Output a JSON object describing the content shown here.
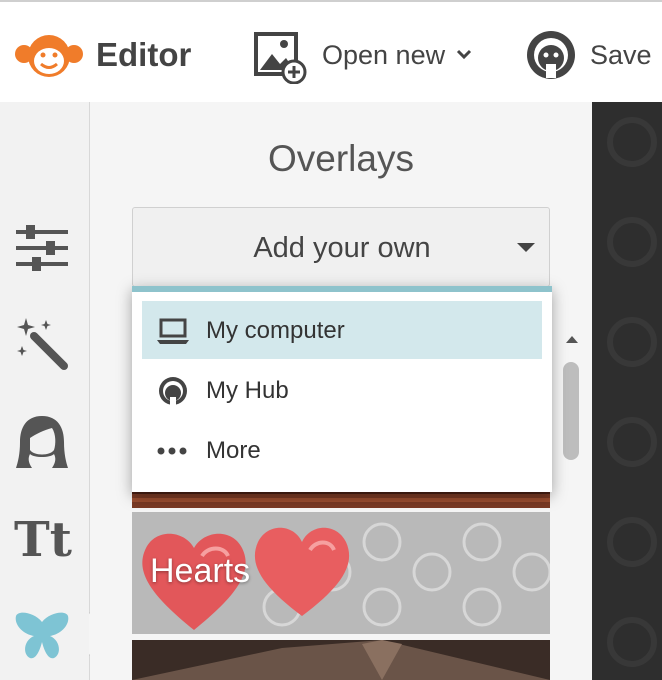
{
  "header": {
    "brand": "Editor",
    "open_new_label": "Open new",
    "save_label": "Save"
  },
  "sidebar": {
    "items": [
      {
        "name": "adjustments",
        "icon": "sliders-icon"
      },
      {
        "name": "effects",
        "icon": "magic-wand-icon"
      },
      {
        "name": "touch-up",
        "icon": "face-icon"
      },
      {
        "name": "text",
        "icon": "text-icon",
        "glyph": "Tt"
      },
      {
        "name": "overlays",
        "icon": "butterfly-icon",
        "active": true
      }
    ]
  },
  "panel": {
    "title": "Overlays",
    "add_own_label": "Add your own",
    "thumbnails": [
      {
        "label": "Hearts"
      }
    ]
  },
  "dropdown": {
    "items": [
      {
        "label": "My computer",
        "icon": "laptop-icon",
        "selected": true
      },
      {
        "label": "My Hub",
        "icon": "hub-icon"
      },
      {
        "label": "More",
        "icon": "more-dots-icon"
      }
    ]
  },
  "colors": {
    "accent": "#8ec3cc",
    "selected_bg": "#d3e8ec",
    "logo": "#f07c2a",
    "butterfly": "#7ec4d4"
  }
}
